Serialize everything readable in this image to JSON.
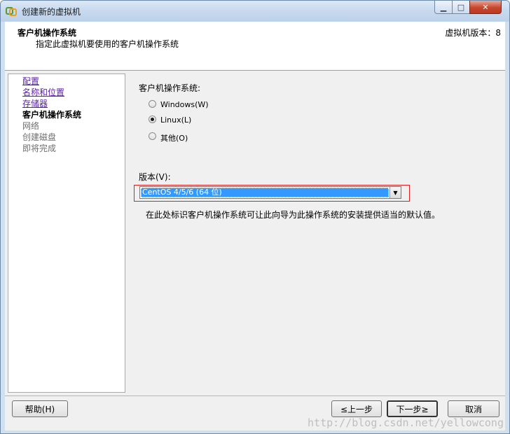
{
  "window": {
    "title": "创建新的虚拟机",
    "controls": {
      "minimize": "▁",
      "maximize": "□",
      "close": "✕"
    }
  },
  "header": {
    "title": "客户机操作系统",
    "subtitle": "指定此虚拟机要使用的客户机操作系统",
    "version": "虚拟机版本：8"
  },
  "nav": {
    "items": [
      {
        "label": "配置",
        "state": "link"
      },
      {
        "label": "名称和位置",
        "state": "link"
      },
      {
        "label": "存储器",
        "state": "link"
      },
      {
        "label": "客户机操作系统",
        "state": "current"
      },
      {
        "label": "网络",
        "state": "disabled"
      },
      {
        "label": "创建磁盘",
        "state": "disabled"
      },
      {
        "label": "即将完成",
        "state": "disabled"
      }
    ]
  },
  "main": {
    "os_label": "客户机操作系统:",
    "os_options": [
      {
        "label": "Windows(W)",
        "checked": false
      },
      {
        "label": "Linux(L)",
        "checked": true
      },
      {
        "label": "其他(O)",
        "checked": false
      }
    ],
    "version_label": "版本(V):",
    "version_selected": "CentOS 4/5/6 (64 位)",
    "description": "在此处标识客户机操作系统可让此向导为此操作系统的安装提供适当的默认值。"
  },
  "footer": {
    "help": "帮助(H)",
    "back": "≤上一步",
    "next": "下一步≥",
    "cancel": "取消"
  },
  "watermark": "http://blog.csdn.net/yellowcong",
  "colors": {
    "accent": "#3399ff",
    "link": "#5a1fa7",
    "highlight": "#e02020"
  }
}
